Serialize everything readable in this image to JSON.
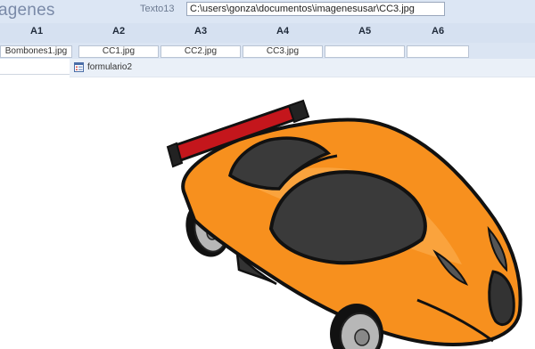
{
  "header": {
    "title": "agenes",
    "field_label": "Texto13",
    "field_value": "C:\\users\\gonza\\documentos\\imagenesusar\\CC3.jpg"
  },
  "columns": [
    {
      "label": "A1"
    },
    {
      "label": "A2"
    },
    {
      "label": "A3"
    },
    {
      "label": "A4"
    },
    {
      "label": "A5"
    },
    {
      "label": "A6"
    }
  ],
  "cells": [
    {
      "value": "Bombones1.jpg"
    },
    {
      "value": "CC1.jpg"
    },
    {
      "value": "CC2.jpg"
    },
    {
      "value": "CC3.jpg"
    },
    {
      "value": ""
    },
    {
      "value": ""
    }
  ],
  "subform": {
    "title": "formulario2",
    "icon": "form-icon",
    "image": "orange sports car cartoon"
  },
  "colors": {
    "header_bg": "#dce6f4",
    "car_orange": "#f7901e",
    "spoiler_red": "#c4161c"
  }
}
